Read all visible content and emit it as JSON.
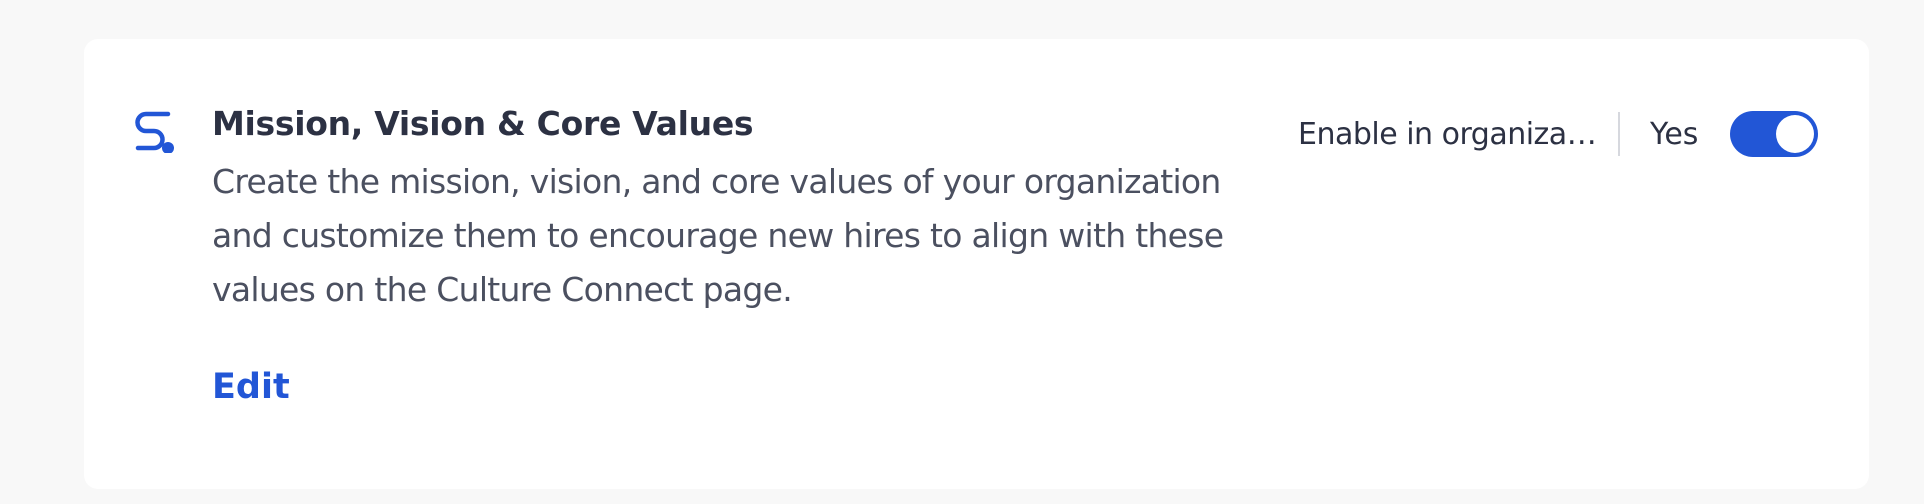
{
  "module": {
    "icon": "route-icon",
    "title": "Mission, Vision & Core Values",
    "description": "Create the mission, vision, and core values of your organization and customize them to encourage new hires to align with these values on the Culture Connect page.",
    "edit_label": "Edit"
  },
  "controls": {
    "scope_select": "Enable in organization",
    "value_select": "Yes",
    "toggle_enabled": true
  },
  "colors": {
    "accent": "#2256d6",
    "title": "#2c3143",
    "description": "#4b5060",
    "page_background": "#f8f8f8",
    "card_background": "#ffffff"
  }
}
